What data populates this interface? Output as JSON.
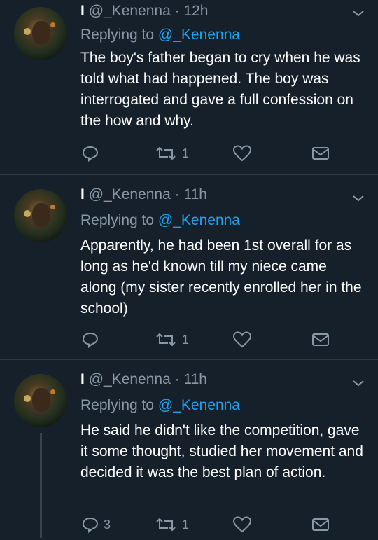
{
  "tweets": [
    {
      "display": "I",
      "handle": "@_Kenenna",
      "time": "12h",
      "replying_prefix": "Replying to ",
      "replying_handle": "@_Kenenna",
      "text": "The boy's father began to cry when he was told what had happened. The boy was interrogated and gave a full confession on the how and why.",
      "reply_count": "",
      "retweet_count": "1"
    },
    {
      "display": "I",
      "handle": "@_Kenenna",
      "time": "11h",
      "replying_prefix": "Replying to ",
      "replying_handle": "@_Kenenna",
      "text": "Apparently, he had been 1st overall for as long as he'd known till my niece came along (my sister recently enrolled her in the school)",
      "reply_count": "",
      "retweet_count": "1"
    },
    {
      "display": "I",
      "handle": "@_Kenenna",
      "time": "11h",
      "replying_prefix": "Replying to ",
      "replying_handle": "@_Kenenna",
      "text": "He said he didn't like the competition, gave it some thought, studied her movement and decided it was the best plan of action.",
      "reply_count": "3",
      "retweet_count": "1"
    }
  ],
  "separator": " · ",
  "icons": [
    "reply-icon",
    "retweet-icon",
    "like-icon",
    "dm-icon",
    "chevron-down-icon",
    "avatar"
  ],
  "colors": {
    "background": "#15202b",
    "text": "#ffffff",
    "muted": "#8899a6",
    "link": "#1da1f2"
  }
}
